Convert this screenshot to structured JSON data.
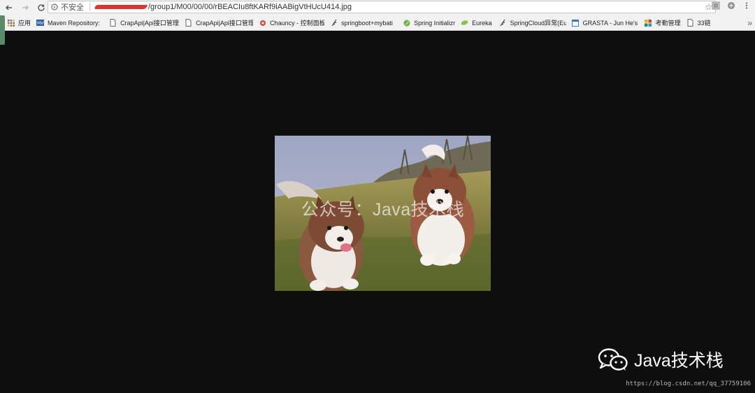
{
  "browser": {
    "security_label": "不安全",
    "url_visible": "/group1/M00/00/00/rBEACIu8ftKARf9iAABigVtHUcU414.jpg"
  },
  "bookmarks": [
    {
      "label": "应用",
      "icon": "apps-grid-icon"
    },
    {
      "label": "Maven Repository:",
      "icon": "maven-icon"
    },
    {
      "label": "CrapApi|Api接口管理",
      "icon": "page-icon"
    },
    {
      "label": "CrapApi|Api接口管理",
      "icon": "page-icon"
    },
    {
      "label": "Chauncy - 控制面板",
      "icon": "gear-red-icon"
    },
    {
      "label": "springboot+mybati",
      "icon": "feather-icon"
    },
    {
      "label": "Spring Initializr",
      "icon": "spring-icon"
    },
    {
      "label": "Eureka",
      "icon": "leaf-icon"
    },
    {
      "label": "SpringCloud异常(Eu",
      "icon": "feather-icon"
    },
    {
      "label": "GRASTA - Jun He's",
      "icon": "calendar-icon"
    },
    {
      "label": "考勤管理",
      "icon": "windmill-icon"
    },
    {
      "label": "33链",
      "icon": "page-icon"
    }
  ],
  "image": {
    "watermark": "公众号：Java技术栈",
    "subject": "two-puppies-photo"
  },
  "footer": {
    "brand_name": "Java技术栈",
    "csdn_url": "https://blog.csdn.net/qq_37759106"
  },
  "colors": {
    "page_background": "#0e0e0e",
    "toolbar": "#f2f2f2",
    "redaction": "#e6322e"
  }
}
